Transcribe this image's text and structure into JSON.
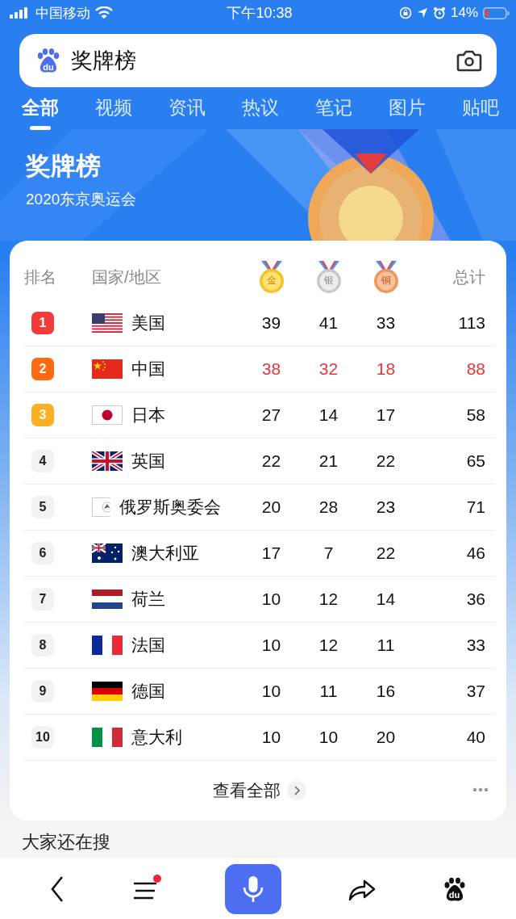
{
  "status_bar": {
    "carrier": "中国移动",
    "time": "下午10:38",
    "battery": "14%"
  },
  "search": {
    "logo_text": "du",
    "query": "奖牌榜"
  },
  "tabs": [
    {
      "label": "全部",
      "selected": true
    },
    {
      "label": "视频",
      "selected": false
    },
    {
      "label": "资讯",
      "selected": false
    },
    {
      "label": "热议",
      "selected": false
    },
    {
      "label": "笔记",
      "selected": false
    },
    {
      "label": "图片",
      "selected": false
    },
    {
      "label": "贴吧",
      "selected": false
    }
  ],
  "hero": {
    "title": "奖牌榜",
    "subtitle": "2020东京奥运会"
  },
  "table": {
    "columns": {
      "rank": "排名",
      "country": "国家/地区",
      "gold": "金",
      "silver": "银",
      "bronze": "铜",
      "total": "总计"
    },
    "rows": [
      {
        "rank": "1",
        "color": "#f23c3c",
        "country": "美国",
        "gold": "39",
        "silver": "41",
        "bronze": "33",
        "total": "113",
        "highlighted": false
      },
      {
        "rank": "2",
        "color": "#ff6a10",
        "country": "中国",
        "gold": "38",
        "silver": "32",
        "bronze": "18",
        "total": "88",
        "highlighted": true
      },
      {
        "rank": "3",
        "color": "#fbb024",
        "country": "日本",
        "gold": "27",
        "silver": "14",
        "bronze": "17",
        "total": "58",
        "highlighted": false
      },
      {
        "rank": "4",
        "color": "#f2f2f4",
        "country": "英国",
        "gold": "22",
        "silver": "21",
        "bronze": "22",
        "total": "65",
        "highlighted": false
      },
      {
        "rank": "5",
        "color": "#f2f2f4",
        "country": "俄罗斯奥委会",
        "gold": "20",
        "silver": "28",
        "bronze": "23",
        "total": "71",
        "highlighted": false
      },
      {
        "rank": "6",
        "color": "#f2f2f4",
        "country": "澳大利亚",
        "gold": "17",
        "silver": "7",
        "bronze": "22",
        "total": "46",
        "highlighted": false
      },
      {
        "rank": "7",
        "color": "#f2f2f4",
        "country": "荷兰",
        "gold": "10",
        "silver": "12",
        "bronze": "14",
        "total": "36",
        "highlighted": false
      },
      {
        "rank": "8",
        "color": "#f2f2f4",
        "country": "法国",
        "gold": "10",
        "silver": "12",
        "bronze": "11",
        "total": "33",
        "highlighted": false
      },
      {
        "rank": "9",
        "color": "#f2f2f4",
        "country": "德国",
        "gold": "10",
        "silver": "11",
        "bronze": "16",
        "total": "37",
        "highlighted": false
      },
      {
        "rank": "10",
        "color": "#f2f2f4",
        "country": "意大利",
        "gold": "10",
        "silver": "10",
        "bronze": "20",
        "total": "40",
        "highlighted": false
      }
    ],
    "view_all": "查看全部"
  },
  "related": {
    "title": "大家还在搜"
  },
  "bottom_nav": {
    "logo_text": "du",
    "menu_badge": true
  }
}
